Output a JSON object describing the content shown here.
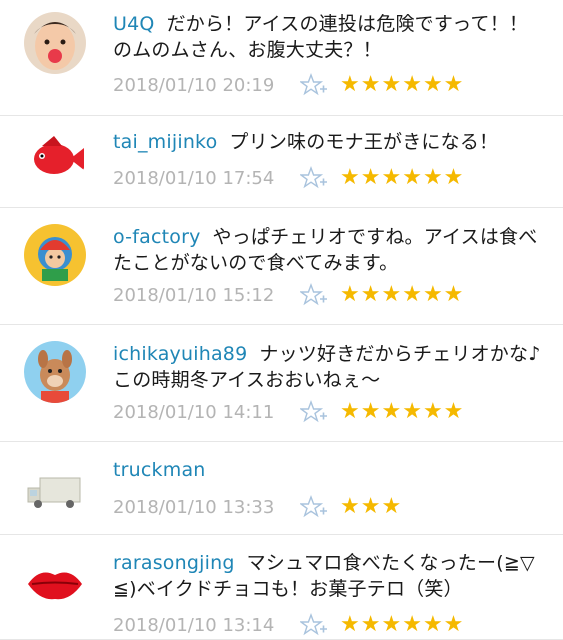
{
  "comments": [
    {
      "user": "U4Q",
      "text": "だから！アイスの連投は危険ですって！！のムのムさん、お腹大丈夫？！",
      "date": "2018/01/10 20:19",
      "star_count": 6,
      "avatar": "child-face-avatar"
    },
    {
      "user": "tai_mijinko",
      "text": "プリン味のモナ王がきになる！",
      "date": "2018/01/10 17:54",
      "star_count": 6,
      "avatar": "red-fish-avatar"
    },
    {
      "user": "o-factory",
      "text": "やっぱチェリオですね。アイスは食べたことがないので食べてみます。",
      "date": "2018/01/10 15:12",
      "star_count": 6,
      "avatar": "illustration-avatar"
    },
    {
      "user": "ichikayuiha89",
      "text": "ナッツ好きだからチェリオかな♪この時期冬アイスおおいねぇ～",
      "date": "2018/01/10 14:11",
      "star_count": 6,
      "avatar": "dog-character-avatar"
    },
    {
      "user": "truckman",
      "text": "",
      "date": "2018/01/10 13:33",
      "star_count": 3,
      "avatar": "truck-avatar"
    },
    {
      "user": "rarasongjing",
      "text": "マシュマロ食べたくなったー(≧▽≦)ベイクドチョコも！お菓子テロ（笑）",
      "date": "2018/01/10 13:14",
      "star_count": 6,
      "avatar": "red-lips-avatar"
    }
  ],
  "icons": {
    "add_star": "star-plus-icon",
    "star": "star-icon"
  },
  "colors": {
    "username": "#1f86b6",
    "star": "#f5b900",
    "date": "#b4b4b4",
    "divider": "#e6e6e6"
  }
}
